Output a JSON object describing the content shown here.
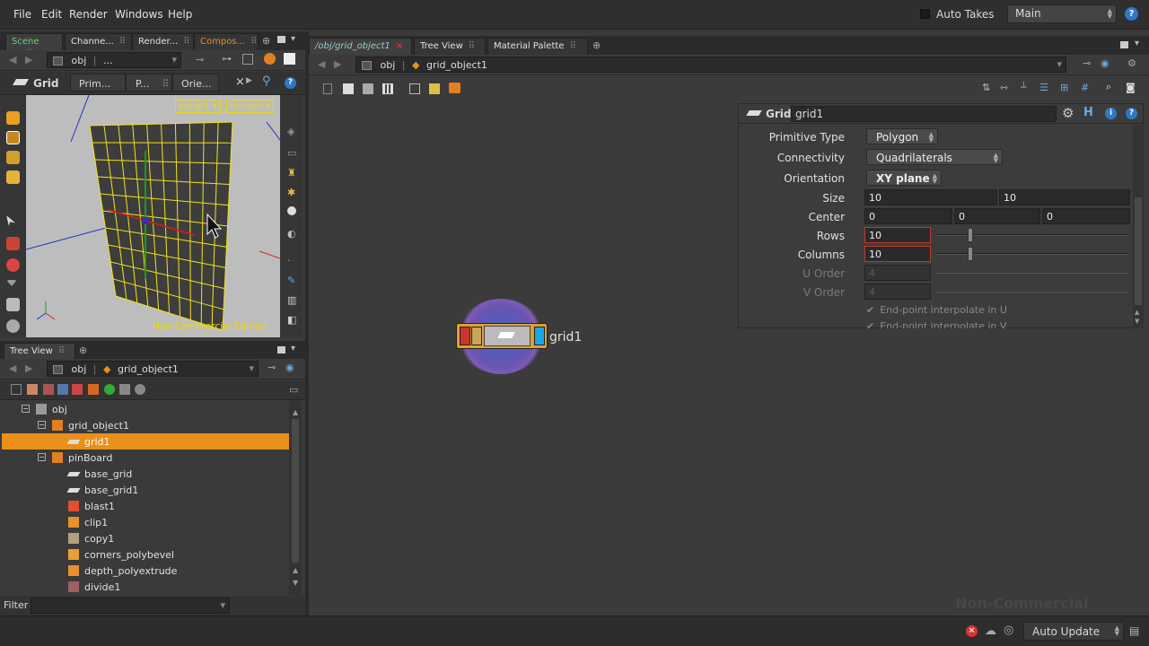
{
  "menubar": {
    "items": [
      "File",
      "Edit",
      "Render",
      "Windows",
      "Help"
    ],
    "auto_takes": "Auto Takes",
    "take": "Main"
  },
  "left_panel": {
    "tabs": [
      "Scene ...",
      "Channe...",
      "Render...",
      "Compos..."
    ],
    "path": "obj",
    "path_extra": "...",
    "tool_tabs": [
      "Grid",
      "Prim...",
      "P...",
      "Orie..."
    ],
    "viewport": {
      "camera_menu": "persp1",
      "cam_menu": "no cam",
      "watermark": "Non-Commercial Edition"
    }
  },
  "tree_panel": {
    "tab": "Tree View",
    "path_root": "obj",
    "path_node": "grid_object1",
    "filter_label": "Filter",
    "rows": [
      {
        "label": "obj",
        "indent": 0,
        "icon": "network-icon",
        "expander": "-"
      },
      {
        "label": "grid_object1",
        "indent": 1,
        "icon": "geo-object-icon",
        "expander": "-"
      },
      {
        "label": "grid1",
        "indent": 2,
        "icon": "grid-sop-icon",
        "expander": "",
        "selected": true
      },
      {
        "label": "pinBoard",
        "indent": 1,
        "icon": "geo-object-icon",
        "expander": "-"
      },
      {
        "label": "base_grid",
        "indent": 2,
        "icon": "grid-sop-icon",
        "expander": ""
      },
      {
        "label": "base_grid1",
        "indent": 2,
        "icon": "grid-sop-icon",
        "expander": ""
      },
      {
        "label": "blast1",
        "indent": 2,
        "icon": "blast-icon",
        "expander": ""
      },
      {
        "label": "clip1",
        "indent": 2,
        "icon": "clip-icon",
        "expander": ""
      },
      {
        "label": "copy1",
        "indent": 2,
        "icon": "copy-icon",
        "expander": ""
      },
      {
        "label": "corners_polybevel",
        "indent": 2,
        "icon": "polybevel-icon",
        "expander": ""
      },
      {
        "label": "depth_polyextrude",
        "indent": 2,
        "icon": "polyextrude-icon",
        "expander": ""
      },
      {
        "label": "divide1",
        "indent": 2,
        "icon": "divide-icon",
        "expander": ""
      }
    ]
  },
  "network_panel": {
    "tabs": [
      "/obj/grid_object1",
      "Tree View",
      "Material Palette"
    ],
    "path_root": "obj",
    "path_node": "grid_object1",
    "node_label": "grid1",
    "watermark": "Non-Commercial Edition"
  },
  "parameters": {
    "node_type": "Grid",
    "node_name": "grid1",
    "primitive_type_label": "Primitive Type",
    "primitive_type": "Polygon",
    "connectivity_label": "Connectivity",
    "connectivity": "Quadrilaterals",
    "orientation_label": "Orientation",
    "orientation": "XY plane",
    "size_label": "Size",
    "size": [
      "10",
      "10"
    ],
    "center_label": "Center",
    "center": [
      "0",
      "0",
      "0"
    ],
    "rows_label": "Rows",
    "rows": "10",
    "columns_label": "Columns",
    "columns": "10",
    "u_order_label": "U Order",
    "u_order": "4",
    "v_order_label": "V Order",
    "v_order": "4",
    "endpoint_u": "End-point interpolate in U",
    "endpoint_v": "End-point interpolate in V"
  },
  "statusbar": {
    "auto_update": "Auto Update"
  },
  "colors": {
    "selection": "#e8901a",
    "grid_wire": "#f2e21c",
    "node_ring": "#7e5bb8"
  }
}
